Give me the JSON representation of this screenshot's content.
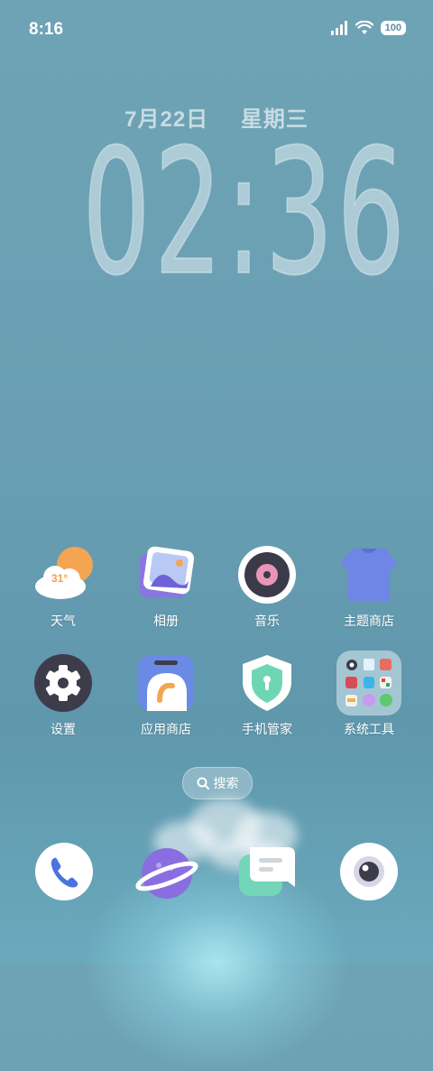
{
  "status_bar": {
    "time": "8:16",
    "battery": "100"
  },
  "clock_widget": {
    "date": "7月22日",
    "weekday": "星期三",
    "time": "02:36"
  },
  "weather_icon": {
    "temperature": "31°"
  },
  "apps": [
    {
      "label": "天气"
    },
    {
      "label": "相册"
    },
    {
      "label": "音乐"
    },
    {
      "label": "主题商店"
    },
    {
      "label": "设置"
    },
    {
      "label": "应用商店"
    },
    {
      "label": "手机管家"
    },
    {
      "label": "系统工具"
    }
  ],
  "search": {
    "label": "搜索"
  },
  "dock": [
    {
      "icon": "phone-icon"
    },
    {
      "icon": "browser-icon"
    },
    {
      "icon": "messages-icon"
    },
    {
      "icon": "camera-icon"
    }
  ]
}
